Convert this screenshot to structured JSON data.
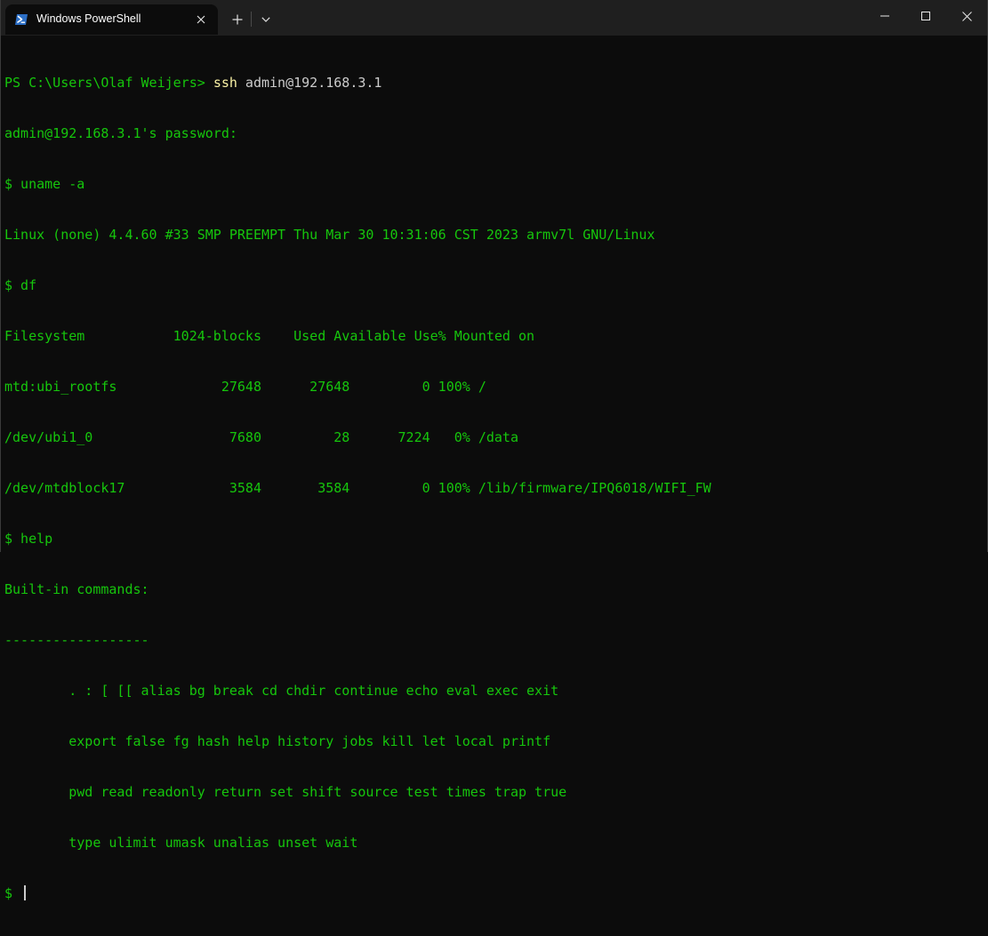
{
  "window": {
    "tab_title": "Windows PowerShell",
    "tab_icon": "powershell-icon",
    "new_tab_icon": "plus-icon",
    "dropdown_icon": "chevron-down-icon",
    "controls": [
      "minimize-icon",
      "maximize-icon",
      "close-icon"
    ]
  },
  "colors": {
    "terminal_bg": "#0c0c0c",
    "titlebar_bg": "#1f1f1f",
    "text_green": "#16c60c",
    "command_yellow": "#f9f1a5",
    "argument_gray": "#cccccc"
  },
  "terminal": {
    "ps_prompt": "PS C:\\Users\\Olaf Weijers> ",
    "ps_command": "ssh",
    "ps_argument": " admin@192.168.3.1",
    "lines": [
      "admin@192.168.3.1's password:",
      "$ uname -a",
      "Linux (none) 4.4.60 #33 SMP PREEMPT Thu Mar 30 10:31:06 CST 2023 armv7l GNU/Linux",
      "$ df",
      "Filesystem           1024-blocks    Used Available Use% Mounted on",
      "mtd:ubi_rootfs             27648      27648         0 100% /",
      "/dev/ubi1_0                 7680         28      7224   0% /data",
      "/dev/mtdblock17             3584       3584         0 100% /lib/firmware/IPQ6018/WIFI_FW",
      "$ help",
      "Built-in commands:",
      "------------------",
      "\t. : [ [[ alias bg break cd chdir continue echo eval exec exit",
      "\texport false fg hash help history jobs kill let local printf",
      "\tpwd read readonly return set shift source test times trap true",
      "\ttype ulimit umask unalias unset wait"
    ],
    "final_prompt": "$ "
  }
}
